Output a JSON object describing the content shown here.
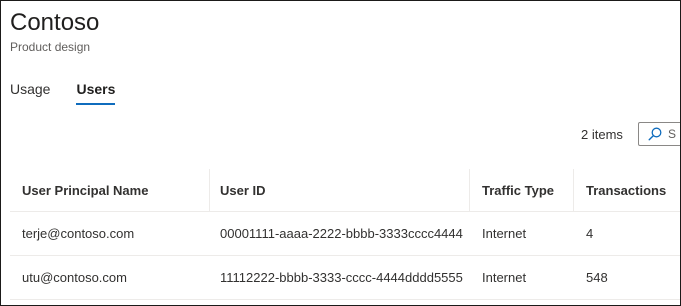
{
  "header": {
    "title": "Contoso",
    "subtitle": "Product design"
  },
  "tabs": [
    {
      "label": "Usage",
      "active": false
    },
    {
      "label": "Users",
      "active": true
    }
  ],
  "toolbar": {
    "items_count": "2 items",
    "search_placeholder": "S",
    "search_icon": "search-icon"
  },
  "table": {
    "columns": [
      "User Principal Name",
      "User ID",
      "Traffic Type",
      "Transactions"
    ],
    "rows": [
      [
        "terje@contoso.com",
        "00001111-aaaa-2222-bbbb-3333cccc4444",
        "Internet",
        "4"
      ],
      [
        "utu@contoso.com",
        "11112222-bbbb-3333-cccc-4444dddd5555",
        "Internet",
        "548"
      ]
    ]
  },
  "colors": {
    "accent": "#0f6cbd",
    "border": "#1b1a19",
    "divider": "#edebe9"
  }
}
